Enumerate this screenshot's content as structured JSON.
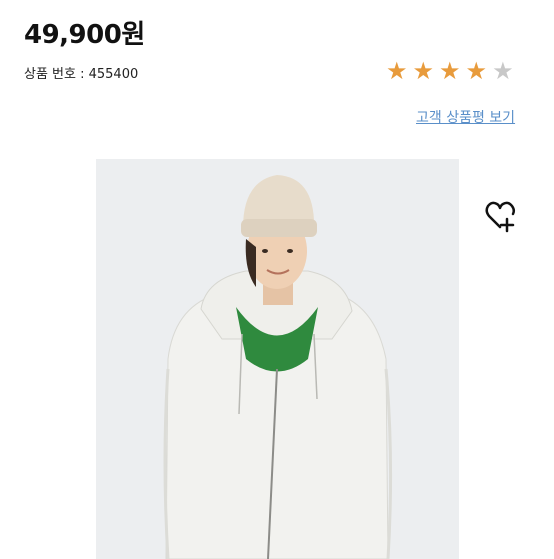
{
  "product": {
    "price": "49,900원",
    "product_number_label": "상품 번호 : 455400",
    "rating": 4,
    "rating_max": 5,
    "review_link": "고객 상품평 보기"
  },
  "colors": {
    "star_filled": "#e89b3c",
    "star_empty": "#c8c8c8",
    "link": "#5a8fc9",
    "photo_background": "#eceef0",
    "hoodie": "#f2f2ef",
    "tshirt": "#2f8a3e",
    "beanie": "#e7dccb"
  },
  "icons": {
    "wishlist": "heart-plus-icon",
    "star": "star-icon"
  }
}
